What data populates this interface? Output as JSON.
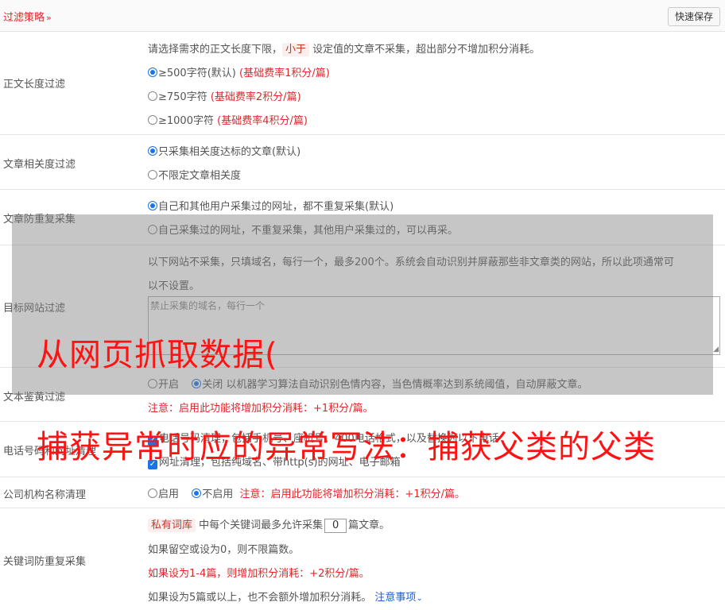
{
  "header": {
    "title": "过滤策略",
    "chevron": "»",
    "save_label": "快速保存"
  },
  "length_filter": {
    "label": "正文长度过滤",
    "desc_prefix": "请选择需求的正文长度下限，",
    "desc_tag": "小于",
    "desc_suffix": "设定值的文章不采集，超出部分不增加积分消耗。",
    "options": [
      {
        "text": "≥500字符(默认)",
        "note": "(基础费率1积分/篇)",
        "selected": true
      },
      {
        "text": "≥750字符",
        "note": "(基础费率2积分/篇)",
        "selected": false
      },
      {
        "text": "≥1000字符",
        "note": "(基础费率4积分/篇)",
        "selected": false
      }
    ]
  },
  "relevance_filter": {
    "label": "文章相关度过滤",
    "options": [
      {
        "text": "只采集相关度达标的文章(默认)",
        "selected": true
      },
      {
        "text": "不限定文章相关度",
        "selected": false
      }
    ]
  },
  "dedup": {
    "label": "文章防重复采集",
    "options": [
      {
        "text": "自己和其他用户采集过的网址，都不重复采集(默认)",
        "selected": true
      },
      {
        "text": "自己采集过的网址，不重复采集，其他用户采集过的，可以再采。",
        "selected": false
      }
    ]
  },
  "site_filter": {
    "label": "目标网站过滤",
    "desc_line1": "以下网站不采集，只填域名，每行一个，最多200个。系统会自动识别并屏蔽那些非文章类的网站，所以此项通常可",
    "desc_line2": "以不设置。",
    "placeholder": "禁止采集的域名，每行一个"
  },
  "porn_filter": {
    "label": "文本鉴黄过滤",
    "opt_on": "开启",
    "opt_off": "关闭",
    "selected": "关闭",
    "desc": "以机器学习算法自动识别色情内容，当色情概率达到系统阈值，自动屏蔽文章。",
    "note": "注意：启用此功能将增加积分消耗：+1积分/篇。"
  },
  "phone_clean": {
    "label": "电话号码和网址清理",
    "line1": "电话号码清理，包括手机号、座机号、400电话格式，以及替换为以下电话：",
    "line2": "网址清理，包括纯域名、带http(s)的网址、电子邮箱"
  },
  "org_clean": {
    "label": "公司机构名称清理",
    "opt_on": "启用",
    "opt_off": "不启用",
    "selected": "不启用",
    "note": "注意：启用此功能将增加积分消耗：+1积分/篇。"
  },
  "keyword_dedup": {
    "label": "关键词防重复采集",
    "tag": "私有词库",
    "line1_mid": "中每个关键词最多允许采集",
    "value": "0",
    "line1_end": "篇文章。",
    "line2": "如果留空或设为0，则不限篇数。",
    "line3": "如果设为1-4篇，则增加积分消耗：+2积分/篇。",
    "line4": "如果设为5篇或以上，也不会额外增加积分消耗。",
    "link": "注意事项",
    "link_icon": "chevron-down-icon"
  },
  "watermark": {
    "line1": "从网页抓取数据(",
    "line2": "捕获异常时应的异常写法：捕获父类的父类"
  }
}
